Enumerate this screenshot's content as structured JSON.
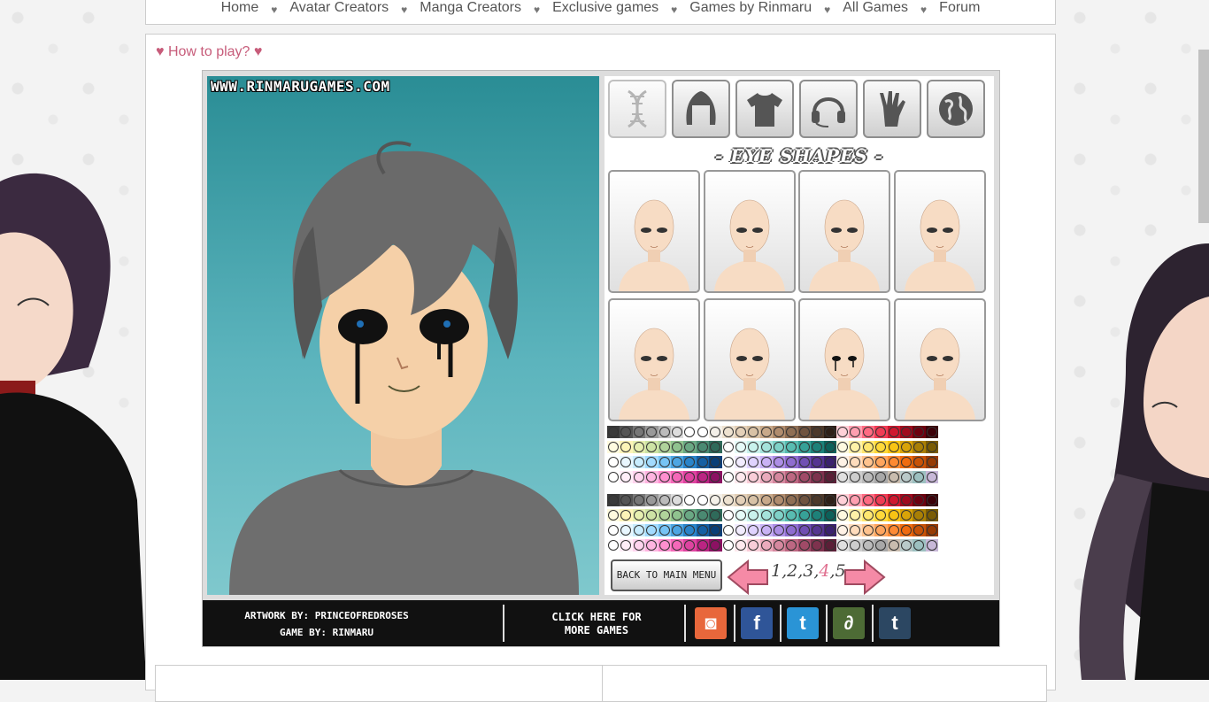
{
  "nav": {
    "items": [
      "Home",
      "Avatar Creators",
      "Manga Creators",
      "Exclusive games",
      "Games by Rinmaru",
      "All Games",
      "Forum"
    ],
    "separator": "♥"
  },
  "howto": "♥ How to play? ♥",
  "game": {
    "watermark": "WWW.RINMARUGAMES.COM",
    "panel_title": "- EYE SHAPES -",
    "categories": [
      "dna-icon",
      "hair-icon",
      "shirt-icon",
      "headset-icon",
      "hand-icon",
      "globe-icon"
    ],
    "thumbnail_count": 8,
    "back_label": "BACK TO MAIN MENU",
    "pages": {
      "before": "1,2,3,",
      "current": "4",
      "after": ",5"
    },
    "credits_line1": "ARTWORK BY: PRINCEOFREDROSES",
    "credits_line2": "GAME BY: RINMARU",
    "more_line1": "CLICK HERE FOR",
    "more_line2": "MORE GAMES",
    "social": [
      {
        "name": "camera-icon",
        "color": "#e8673b",
        "glyph": "◙"
      },
      {
        "name": "facebook-icon",
        "color": "#2f5598",
        "glyph": "f"
      },
      {
        "name": "twitter-icon",
        "color": "#2a94d6",
        "glyph": "t"
      },
      {
        "name": "deviantart-icon",
        "color": "#4d6b35",
        "glyph": "∂"
      },
      {
        "name": "tumblr-icon",
        "color": "#2c4762",
        "glyph": "t"
      }
    ]
  },
  "colors": {
    "palette1": [
      [
        "#3a3a3a",
        "#555",
        "#777",
        "#999",
        "#bbb",
        "#ddd",
        "#fff",
        "#fff",
        "#f4f0e8",
        "#eee2d0",
        "#e4d0b8",
        "#d8c2a6",
        "#c8a98a",
        "#b08c6e",
        "#8f6f55",
        "#6f533f",
        "#4d392b",
        "#2e2018",
        "#ffd0d8",
        "#ff9fb0",
        "#ff6b82",
        "#f03c55",
        "#d0182f",
        "#a00a1e",
        "#6d0010",
        "#3c0008"
      ],
      [
        "#fffbe0",
        "#fdf4b8",
        "#e6efb0",
        "#cde3a5",
        "#b0d39b",
        "#90c38f",
        "#6aa884",
        "#4a8a72",
        "#2f6a5a",
        "#ffffff",
        "#e6fbf8",
        "#c9f2ec",
        "#a4e3db",
        "#7fd2c8",
        "#58bcb1",
        "#37a197",
        "#1d8179",
        "#0c615a",
        "#fff9e0",
        "#fff2a8",
        "#ffe770",
        "#ffd93a",
        "#f8c414",
        "#d8a308",
        "#a97f05",
        "#7a5c03"
      ],
      [
        "#ffffff",
        "#e8f7ff",
        "#c8ecff",
        "#a2dbff",
        "#77c4f5",
        "#4da6e3",
        "#2a84c9",
        "#155fa3",
        "#093f78",
        "#ffffff",
        "#f2ecff",
        "#e0d3ff",
        "#c9b2f5",
        "#ad8ee6",
        "#8f6dd0",
        "#714fb3",
        "#553592",
        "#3b216f",
        "#fff2e6",
        "#ffdcbc",
        "#ffc38e",
        "#ffa55e",
        "#ff8a33",
        "#ef6b10",
        "#c75208",
        "#983b04"
      ],
      [
        "#ffffff",
        "#ffeef8",
        "#ffd4ee",
        "#ffb4e0",
        "#ff8fcf",
        "#f568b9",
        "#de43a0",
        "#bb2483",
        "#8c1163",
        "#ffffff",
        "#ffe9ee",
        "#f9cdd8",
        "#eaaabc",
        "#d6889f",
        "#bd6782",
        "#a04a67",
        "#7e324e",
        "#5b1f37",
        "#e0e0e0",
        "#cdcdcd",
        "#bcbcbc",
        "#a8a8a8",
        "#c9bcae",
        "#b9c9c9",
        "#9cc0c0",
        "#c8b8d8"
      ]
    ]
  }
}
